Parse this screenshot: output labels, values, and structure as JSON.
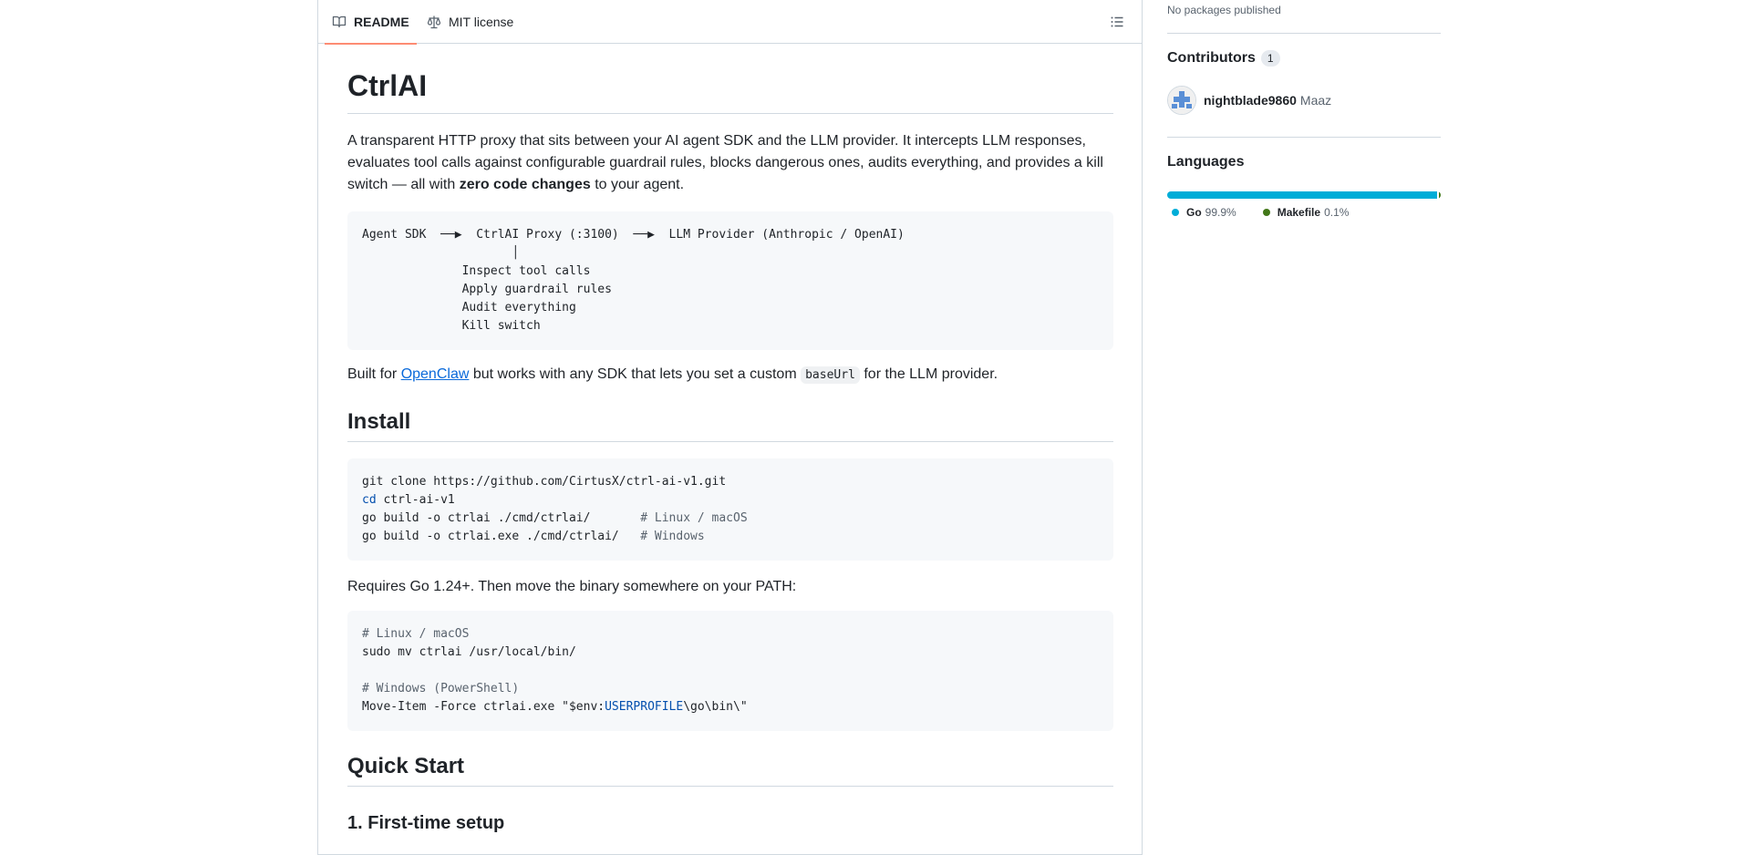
{
  "tabs": {
    "readme": "README",
    "license": "MIT license"
  },
  "readme": {
    "title": "CtrlAI",
    "intro_before": "A transparent HTTP proxy that sits between your AI agent SDK and the LLM provider. It intercepts LLM responses, evaluates tool calls against configurable guardrail rules, blocks dangerous ones, audits everything, and provides a kill switch — all with ",
    "intro_bold": "zero code changes",
    "intro_after": " to your agent.",
    "diagram": {
      "line1": "Agent SDK  ──▶  CtrlAI Proxy (:3100)  ──▶  LLM Provider (Anthropic / OpenAI)",
      "line2": "                     │",
      "line3": "              Inspect tool calls",
      "line4": "              Apply guardrail rules",
      "line5": "              Audit everything",
      "line6": "              Kill switch"
    },
    "built_before": "Built for ",
    "built_link": "OpenClaw",
    "built_middle": " but works with any SDK that lets you set a custom ",
    "built_code": "baseUrl",
    "built_after": " for the LLM provider.",
    "install_heading": "Install",
    "install": {
      "l1": "git clone https://github.com/CirtusX/ctrl-ai-v1.git",
      "l2_kw": "cd",
      "l2_rest": " ctrl-ai-v1",
      "l3": "go build -o ctrlai ./cmd/ctrlai/       ",
      "l3_comment": "# Linux / macOS",
      "l4": "go build -o ctrlai.exe ./cmd/ctrlai/   ",
      "l4_comment": "# Windows"
    },
    "requires": "Requires Go 1.24+. Then move the binary somewhere on your PATH:",
    "path": {
      "c1": "# Linux / macOS",
      "l1": "sudo mv ctrlai /usr/local/bin/",
      "c2": "# Windows (PowerShell)",
      "l2_a": "Move-Item -Force ctrlai.exe \"$env:",
      "l2_kw": "USERPROFILE",
      "l2_b": "\\go\\bin\\\""
    },
    "quick_heading": "Quick Start",
    "first_setup": "1. First-time setup"
  },
  "sidebar": {
    "packages_text": "No packages published",
    "contributors_heading": "Contributors",
    "contributors_count": "1",
    "contributor_login": "nightblade9860",
    "contributor_name": "Maaz",
    "languages_heading": "Languages",
    "languages": [
      {
        "name": "Go",
        "pct": "99.9%",
        "value": 99.9,
        "color": "#00add8"
      },
      {
        "name": "Makefile",
        "pct": "0.1%",
        "value": 0.1,
        "color": "#427819"
      }
    ]
  }
}
